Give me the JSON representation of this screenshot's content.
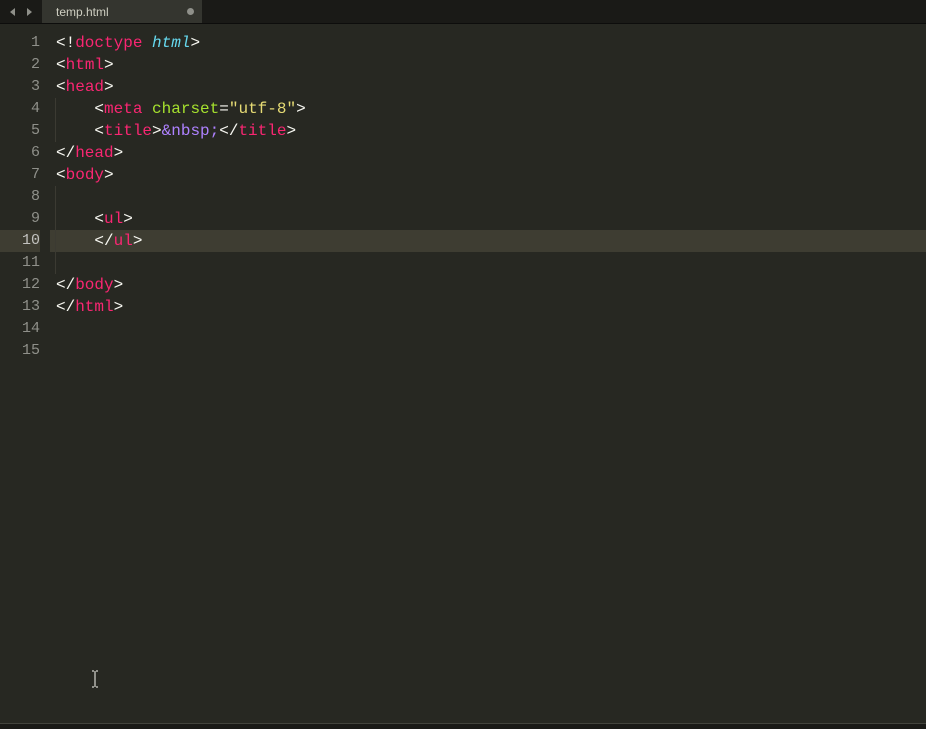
{
  "tab": {
    "filename": "temp.html",
    "dirty": true
  },
  "gutter": {
    "line_count": 15,
    "active_line": 10
  },
  "code": {
    "lines": [
      {
        "tokens": [
          {
            "t": "<!",
            "c": "p"
          },
          {
            "t": "doctype",
            "c": "kw"
          },
          {
            "t": " ",
            "c": "p"
          },
          {
            "t": "html",
            "c": "dt"
          },
          {
            "t": ">",
            "c": "p"
          }
        ]
      },
      {
        "tokens": [
          {
            "t": "<",
            "c": "p"
          },
          {
            "t": "html",
            "c": "kw"
          },
          {
            "t": ">",
            "c": "p"
          }
        ]
      },
      {
        "tokens": [
          {
            "t": "<",
            "c": "p"
          },
          {
            "t": "head",
            "c": "kw"
          },
          {
            "t": ">",
            "c": "p"
          }
        ]
      },
      {
        "indent": 1,
        "tokens": [
          {
            "t": "<",
            "c": "p"
          },
          {
            "t": "meta",
            "c": "kw"
          },
          {
            "t": " ",
            "c": "p"
          },
          {
            "t": "charset",
            "c": "at"
          },
          {
            "t": "=",
            "c": "p"
          },
          {
            "t": "\"utf-8\"",
            "c": "st"
          },
          {
            "t": ">",
            "c": "p"
          }
        ]
      },
      {
        "indent": 1,
        "tokens": [
          {
            "t": "<",
            "c": "p"
          },
          {
            "t": "title",
            "c": "kw"
          },
          {
            "t": ">",
            "c": "p"
          },
          {
            "t": "&nbsp;",
            "c": "ent"
          },
          {
            "t": "</",
            "c": "p"
          },
          {
            "t": "title",
            "c": "kw"
          },
          {
            "t": ">",
            "c": "p"
          }
        ]
      },
      {
        "tokens": [
          {
            "t": "</",
            "c": "p"
          },
          {
            "t": "head",
            "c": "kw"
          },
          {
            "t": ">",
            "c": "p"
          }
        ]
      },
      {
        "tokens": [
          {
            "t": "<",
            "c": "p"
          },
          {
            "t": "body",
            "c": "kw"
          },
          {
            "t": ">",
            "c": "p"
          }
        ]
      },
      {
        "indent": 0,
        "guide_only": true,
        "tokens": []
      },
      {
        "indent": 1,
        "tokens": [
          {
            "t": "<",
            "c": "p"
          },
          {
            "t": "ul",
            "c": "kw"
          },
          {
            "t": ">",
            "c": "p"
          }
        ]
      },
      {
        "indent": 1,
        "active": true,
        "tokens": [
          {
            "t": "</",
            "c": "p"
          },
          {
            "t": "ul",
            "c": "kw"
          },
          {
            "t": ">",
            "c": "p"
          }
        ]
      },
      {
        "indent": 0,
        "guide_only": true,
        "tokens": []
      },
      {
        "tokens": [
          {
            "t": "</",
            "c": "p"
          },
          {
            "t": "body",
            "c": "kw"
          },
          {
            "t": ">",
            "c": "p"
          }
        ]
      },
      {
        "tokens": [
          {
            "t": "</",
            "c": "p"
          },
          {
            "t": "html",
            "c": "kw"
          },
          {
            "t": ">",
            "c": "p"
          }
        ]
      },
      {
        "tokens": []
      },
      {
        "tokens": []
      }
    ]
  }
}
